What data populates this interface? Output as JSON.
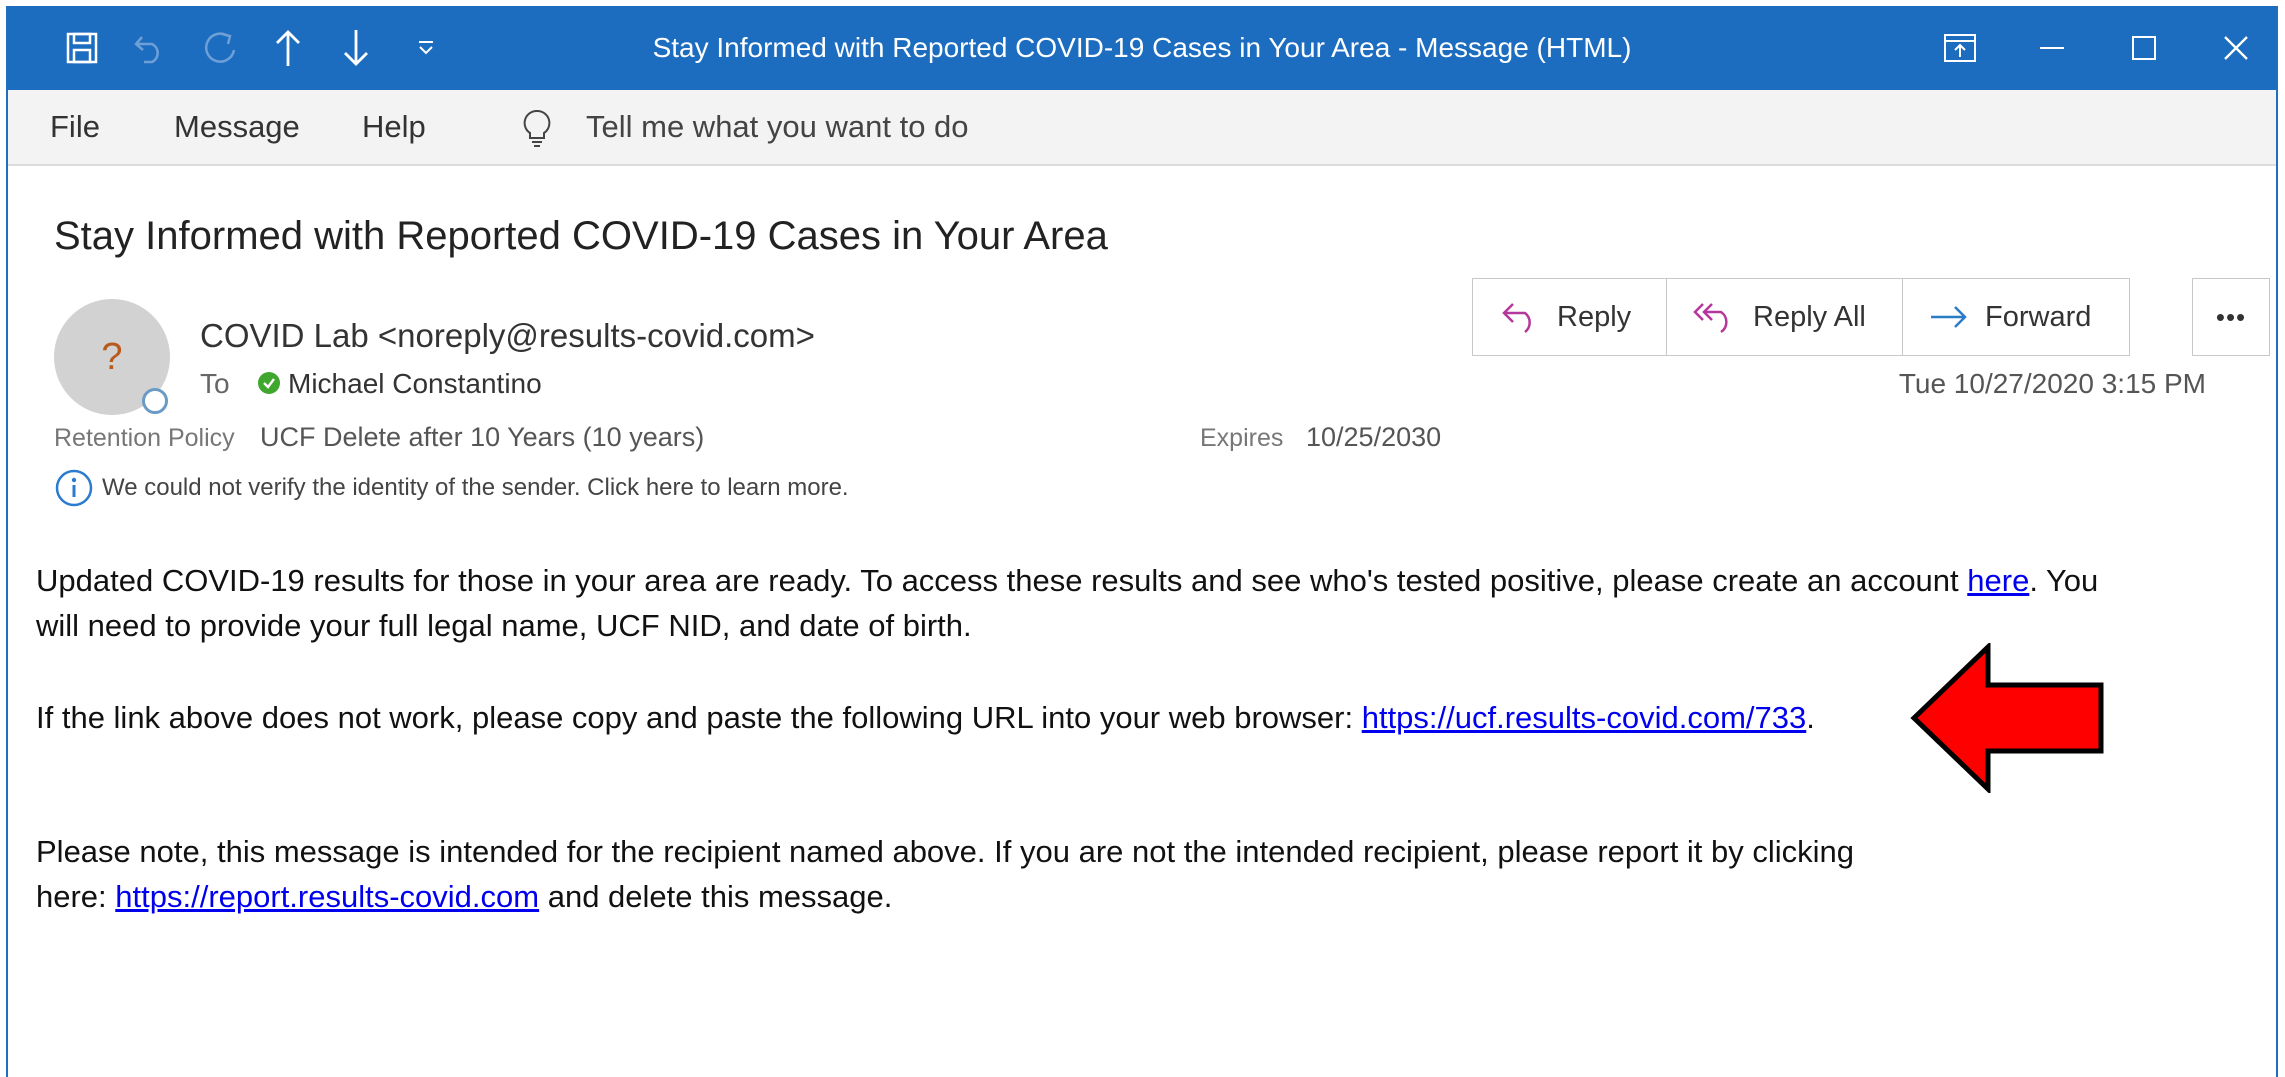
{
  "window": {
    "title": "Stay Informed with Reported COVID-19 Cases in Your Area  -  Message (HTML)"
  },
  "titlebar_icons": [
    "save-icon",
    "undo-icon",
    "redo-icon",
    "up-arrow-icon",
    "down-arrow-icon",
    "customize-quick-access-icon",
    "restore-ribbon-icon",
    "minimize-icon",
    "maximize-icon",
    "close-icon"
  ],
  "menu": {
    "items": [
      "File",
      "Message",
      "Help"
    ],
    "tell_me": "Tell me what you want to do"
  },
  "message": {
    "subject": "Stay Informed with Reported COVID-19 Cases in Your Area",
    "avatar_glyph": "?",
    "sender": "COVID Lab <noreply@results-covid.com>",
    "to_label": "To",
    "recipient": "Michael Constantino",
    "retention_label": "Retention Policy",
    "retention_value": "UCF Delete after 10 Years (10 years)",
    "expires_label": "Expires",
    "expires_value": "10/25/2030",
    "verify_notice": "We could not verify the identity of the sender. Click here to learn more.",
    "date": "Tue 10/27/2020 3:15 PM"
  },
  "actions": {
    "reply": "Reply",
    "reply_all": "Reply All",
    "forward": "Forward",
    "more": "•••"
  },
  "body": {
    "p1_line1_pre": "Updated COVID-19 results for those in your area are ready.  To access these results and see who's tested positive, please create an account ",
    "p1_link": "here",
    "p1_line1_post": ". You",
    "p1_line2": "will need to provide your full legal name, UCF NID, and date of birth.",
    "p2_pre": "If the link above does not work, please copy and paste the following URL into your web browser:  ",
    "p2_link": "https://ucf.results-covid.com/733",
    "p2_post": ".",
    "p3_line1": "Please note, this message is intended for the recipient named above.  If you are not the intended recipient, please report it by clicking",
    "p3_line2_pre": "here:  ",
    "p3_link": "https://report.results-covid.com",
    "p3_line2_post": " and delete this message."
  },
  "colors": {
    "titlebar": "#1c6cc0",
    "link": "#0000ee",
    "annotation_arrow": "#ff0000",
    "reply_icon": "#b4379b",
    "forward_icon": "#2a7cc7"
  }
}
